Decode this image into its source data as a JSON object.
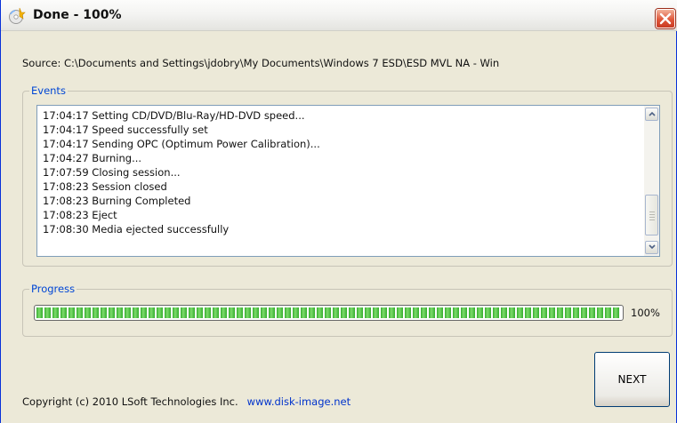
{
  "window": {
    "title": "Done - 100%",
    "close_icon": "close-icon",
    "app_icon": "disc-burner-icon"
  },
  "source": {
    "text": "Source: C:\\Documents and Settings\\jdobry\\My Documents\\Windows 7 ESD\\ESD MVL NA - Win"
  },
  "events": {
    "label": "Events",
    "lines": [
      "17:04:17 Setting CD/DVD/Blu-Ray/HD-DVD speed...",
      "17:04:17 Speed successfully set",
      "17:04:17 Sending OPC (Optimum Power Calibration)...",
      "17:04:27 Burning...",
      "17:07:59 Closing session...",
      "17:08:23 Session closed",
      "17:08:23 Burning Completed",
      "17:08:23 Eject",
      "17:08:30 Media ejected successfully"
    ]
  },
  "progress": {
    "label": "Progress",
    "percent_text": "100%",
    "value": 1.0,
    "fill_color": "#35ad2e"
  },
  "footer": {
    "copyright": "Copyright (c) 2010 LSoft Technologies Inc.",
    "link": "www.disk-image.net"
  },
  "buttons": {
    "next": "NEXT"
  },
  "colors": {
    "accent": "#0046d5",
    "close_button": "#e0573a",
    "window_bg": "#ece9d8"
  }
}
